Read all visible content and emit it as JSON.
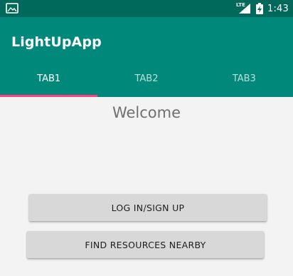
{
  "status_bar": {
    "left_icon": "gallery-icon",
    "network_label": "LTE",
    "signal_icon": "signal-icon",
    "battery_icon": "battery-charging-icon",
    "time": "1:43",
    "background_color": "#00695c"
  },
  "app_bar": {
    "title": "LightUpApp",
    "background_color": "#00897b"
  },
  "tabs": [
    {
      "label": "TAB1",
      "active": true
    },
    {
      "label": "TAB2",
      "active": false
    },
    {
      "label": "TAB3",
      "active": false
    }
  ],
  "indicator_color": "#ff4081",
  "main": {
    "welcome": "Welcome",
    "buttons": {
      "login_label": "LOG IN/SIGN UP",
      "find_label": "FIND RESOURCES NEARBY"
    }
  }
}
